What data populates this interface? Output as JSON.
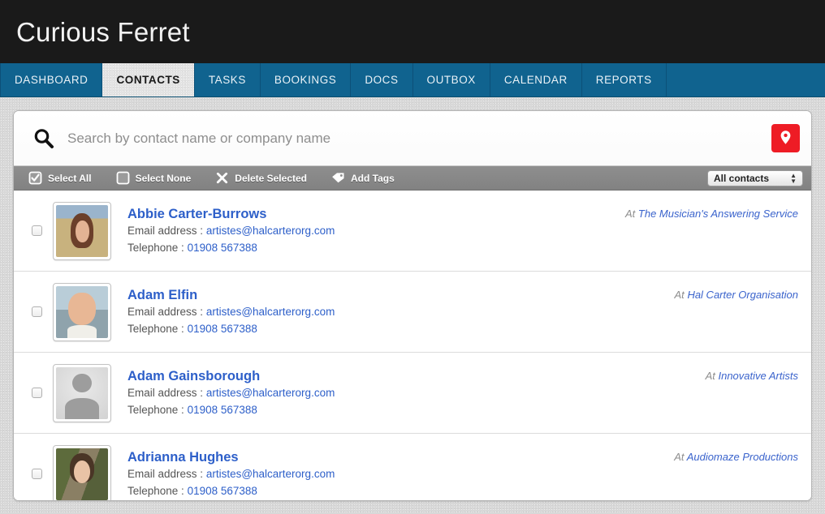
{
  "app": {
    "title": "Curious Ferret"
  },
  "nav": {
    "tabs": [
      {
        "label": "DASHBOARD",
        "active": false
      },
      {
        "label": "CONTACTS",
        "active": true
      },
      {
        "label": "TASKS",
        "active": false
      },
      {
        "label": "BOOKINGS",
        "active": false
      },
      {
        "label": "DOCS",
        "active": false
      },
      {
        "label": "OUTBOX",
        "active": false
      },
      {
        "label": "CALENDAR",
        "active": false
      },
      {
        "label": "REPORTS",
        "active": false
      }
    ]
  },
  "search": {
    "placeholder": "Search by contact name or company name",
    "value": "",
    "icon": "search-icon",
    "map_button": {
      "icon": "map-pin-icon",
      "color": "#ee1c25"
    }
  },
  "toolbar": {
    "actions": [
      {
        "label": "Select All",
        "icon": "checkbox-checked-icon"
      },
      {
        "label": "Select None",
        "icon": "checkbox-empty-icon"
      },
      {
        "label": "Delete Selected",
        "icon": "close-x-icon"
      },
      {
        "label": "Add Tags",
        "icon": "tag-icon"
      }
    ],
    "filter": {
      "selected": "All contacts",
      "options": [
        "All contacts"
      ],
      "icon": "updown-arrows-icon"
    }
  },
  "labels": {
    "email_label": "Email address :",
    "telephone_label": "Telephone :",
    "at_word": "At"
  },
  "contacts": [
    {
      "name": "Abbie Carter-Burrows",
      "email": "artistes@halcarterorg.com",
      "telephone": "01908 567388",
      "company": "The Musician's Answering Service",
      "avatar": "photo-woman-field",
      "selected": false
    },
    {
      "name": "Adam Elfin",
      "email": "artistes@halcarterorg.com",
      "telephone": "01908 567388",
      "company": "Hal Carter Organisation",
      "avatar": "photo-man-smiling",
      "selected": false
    },
    {
      "name": "Adam Gainsborough",
      "email": "artistes@halcarterorg.com",
      "telephone": "01908 567388",
      "company": "Innovative Artists",
      "avatar": "placeholder-silhouette",
      "selected": false
    },
    {
      "name": "Adrianna Hughes",
      "email": "artistes@halcarterorg.com",
      "telephone": "01908 567388",
      "company": "Audiomaze Productions",
      "avatar": "photo-woman-tree",
      "selected": false
    }
  ],
  "colors": {
    "masthead_bg": "#1a1a1a",
    "nav_bg": "#10638f",
    "link_blue": "#2d5fc9",
    "accent_red": "#ee1c25",
    "toolbar_gray": "#888888"
  }
}
